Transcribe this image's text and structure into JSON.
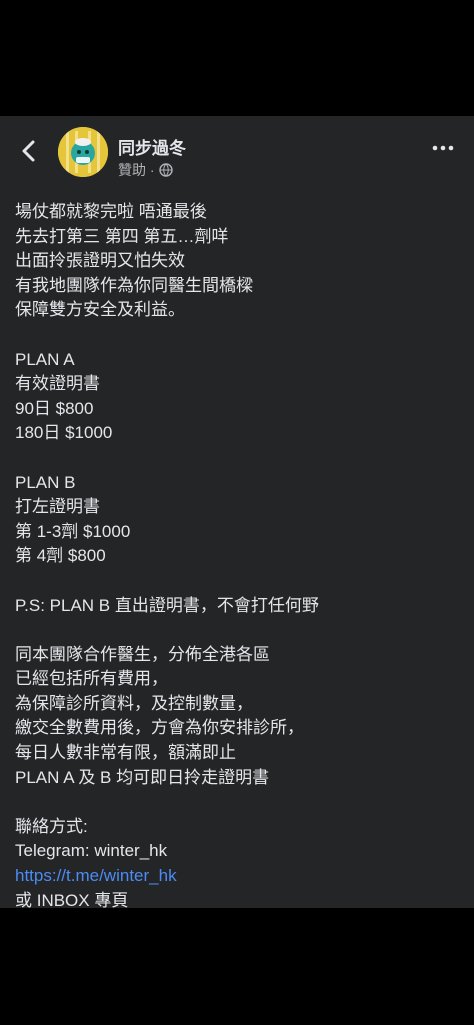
{
  "header": {
    "page_name": "同步過冬",
    "sponsored": "贊助 ·"
  },
  "post": {
    "lines": [
      "場仗都就黎完啦 唔通最後",
      "先去打第三 第四 第五…劑咩",
      "出面拎張證明又怕失效",
      "有我地團隊作為你同醫生間橋樑",
      "保障雙方安全及利益。",
      "",
      "PLAN A",
      "有效證明書",
      "90日 $800",
      "180日 $1000",
      "",
      "PLAN B",
      "打左證明書",
      "第 1-3劑 $1000",
      "第 4劑 $800",
      "",
      "P.S: PLAN B 直出證明書，不會打任何野",
      "",
      "同本團隊合作醫生，分佈全港各區",
      "已經包括所有費用，",
      "為保障診所資料，及控制數量，",
      "繳交全數費用後，方會為你安排診所，",
      "每日人數非常有限，額滿即止",
      "PLAN A 及 B 均可即日拎走證明書",
      "",
      "聯絡方式:",
      "Telegram: winter_hk"
    ],
    "link": "https://t.me/winter_hk",
    "last_line": "或 INBOX 專頁"
  },
  "icons": {
    "back": "chevron-left-icon",
    "avatar": "cartoon-avatar",
    "privacy": "globe-icon",
    "more": "more-dots-icon"
  },
  "colors": {
    "card_bg": "#242526",
    "text": "#e4e6eb",
    "secondary_text": "#b0b3b8",
    "link": "#4c8bf5",
    "avatar_bg": "#e5c63a"
  }
}
